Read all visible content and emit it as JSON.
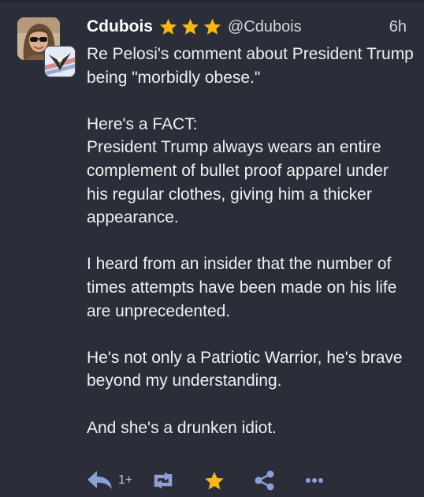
{
  "post": {
    "author_name": "Cdubois",
    "handle": "@Cdubois",
    "time": "6h",
    "paragraphs": [
      "Re Pelosi's comment about President Trump being \"morbidly obese.\"",
      "Here's a FACT:\nPresident Trump always wears an entire complement of bullet proof apparel under his regular clothes, giving him a thicker appearance.",
      "I heard from an insider that the number of times attempts have been made on his life are unprecedented.",
      "He's not only a Patriotic Warrior, he's brave beyond my understanding.",
      "And she's a drunken idiot."
    ]
  },
  "actions": {
    "reply_count": "1+"
  },
  "icons": [
    "star-icon",
    "reply-icon",
    "boost-icon",
    "favourite-icon",
    "share-icon",
    "more-icon"
  ],
  "colors": {
    "background": "#2b2e38",
    "accent": "#8c9fd8",
    "star": "#f5b81b",
    "text": "#eef0f3"
  }
}
